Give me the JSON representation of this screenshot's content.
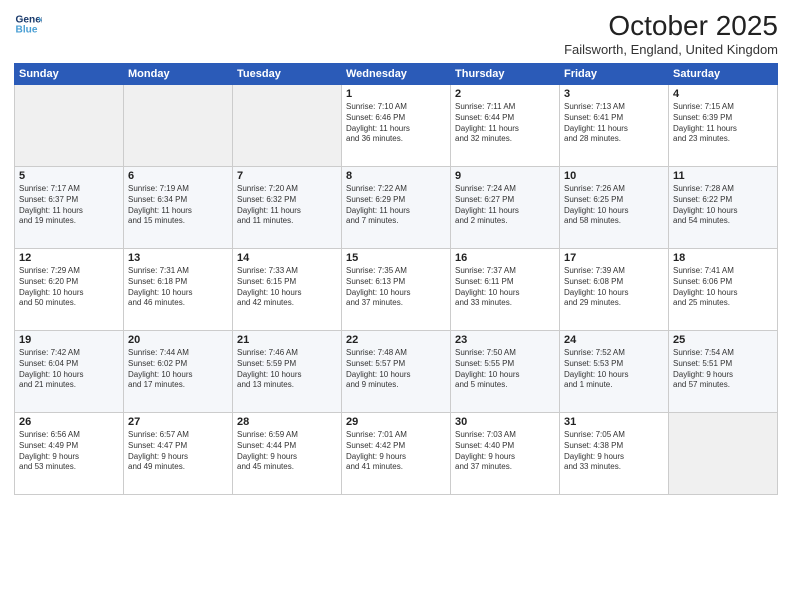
{
  "header": {
    "logo_line1": "General",
    "logo_line2": "Blue",
    "title": "October 2025",
    "location": "Failsworth, England, United Kingdom"
  },
  "days_of_week": [
    "Sunday",
    "Monday",
    "Tuesday",
    "Wednesday",
    "Thursday",
    "Friday",
    "Saturday"
  ],
  "weeks": [
    [
      {
        "day": "",
        "info": ""
      },
      {
        "day": "",
        "info": ""
      },
      {
        "day": "",
        "info": ""
      },
      {
        "day": "1",
        "info": "Sunrise: 7:10 AM\nSunset: 6:46 PM\nDaylight: 11 hours\nand 36 minutes."
      },
      {
        "day": "2",
        "info": "Sunrise: 7:11 AM\nSunset: 6:44 PM\nDaylight: 11 hours\nand 32 minutes."
      },
      {
        "day": "3",
        "info": "Sunrise: 7:13 AM\nSunset: 6:41 PM\nDaylight: 11 hours\nand 28 minutes."
      },
      {
        "day": "4",
        "info": "Sunrise: 7:15 AM\nSunset: 6:39 PM\nDaylight: 11 hours\nand 23 minutes."
      }
    ],
    [
      {
        "day": "5",
        "info": "Sunrise: 7:17 AM\nSunset: 6:37 PM\nDaylight: 11 hours\nand 19 minutes."
      },
      {
        "day": "6",
        "info": "Sunrise: 7:19 AM\nSunset: 6:34 PM\nDaylight: 11 hours\nand 15 minutes."
      },
      {
        "day": "7",
        "info": "Sunrise: 7:20 AM\nSunset: 6:32 PM\nDaylight: 11 hours\nand 11 minutes."
      },
      {
        "day": "8",
        "info": "Sunrise: 7:22 AM\nSunset: 6:29 PM\nDaylight: 11 hours\nand 7 minutes."
      },
      {
        "day": "9",
        "info": "Sunrise: 7:24 AM\nSunset: 6:27 PM\nDaylight: 11 hours\nand 2 minutes."
      },
      {
        "day": "10",
        "info": "Sunrise: 7:26 AM\nSunset: 6:25 PM\nDaylight: 10 hours\nand 58 minutes."
      },
      {
        "day": "11",
        "info": "Sunrise: 7:28 AM\nSunset: 6:22 PM\nDaylight: 10 hours\nand 54 minutes."
      }
    ],
    [
      {
        "day": "12",
        "info": "Sunrise: 7:29 AM\nSunset: 6:20 PM\nDaylight: 10 hours\nand 50 minutes."
      },
      {
        "day": "13",
        "info": "Sunrise: 7:31 AM\nSunset: 6:18 PM\nDaylight: 10 hours\nand 46 minutes."
      },
      {
        "day": "14",
        "info": "Sunrise: 7:33 AM\nSunset: 6:15 PM\nDaylight: 10 hours\nand 42 minutes."
      },
      {
        "day": "15",
        "info": "Sunrise: 7:35 AM\nSunset: 6:13 PM\nDaylight: 10 hours\nand 37 minutes."
      },
      {
        "day": "16",
        "info": "Sunrise: 7:37 AM\nSunset: 6:11 PM\nDaylight: 10 hours\nand 33 minutes."
      },
      {
        "day": "17",
        "info": "Sunrise: 7:39 AM\nSunset: 6:08 PM\nDaylight: 10 hours\nand 29 minutes."
      },
      {
        "day": "18",
        "info": "Sunrise: 7:41 AM\nSunset: 6:06 PM\nDaylight: 10 hours\nand 25 minutes."
      }
    ],
    [
      {
        "day": "19",
        "info": "Sunrise: 7:42 AM\nSunset: 6:04 PM\nDaylight: 10 hours\nand 21 minutes."
      },
      {
        "day": "20",
        "info": "Sunrise: 7:44 AM\nSunset: 6:02 PM\nDaylight: 10 hours\nand 17 minutes."
      },
      {
        "day": "21",
        "info": "Sunrise: 7:46 AM\nSunset: 5:59 PM\nDaylight: 10 hours\nand 13 minutes."
      },
      {
        "day": "22",
        "info": "Sunrise: 7:48 AM\nSunset: 5:57 PM\nDaylight: 10 hours\nand 9 minutes."
      },
      {
        "day": "23",
        "info": "Sunrise: 7:50 AM\nSunset: 5:55 PM\nDaylight: 10 hours\nand 5 minutes."
      },
      {
        "day": "24",
        "info": "Sunrise: 7:52 AM\nSunset: 5:53 PM\nDaylight: 10 hours\nand 1 minute."
      },
      {
        "day": "25",
        "info": "Sunrise: 7:54 AM\nSunset: 5:51 PM\nDaylight: 9 hours\nand 57 minutes."
      }
    ],
    [
      {
        "day": "26",
        "info": "Sunrise: 6:56 AM\nSunset: 4:49 PM\nDaylight: 9 hours\nand 53 minutes."
      },
      {
        "day": "27",
        "info": "Sunrise: 6:57 AM\nSunset: 4:47 PM\nDaylight: 9 hours\nand 49 minutes."
      },
      {
        "day": "28",
        "info": "Sunrise: 6:59 AM\nSunset: 4:44 PM\nDaylight: 9 hours\nand 45 minutes."
      },
      {
        "day": "29",
        "info": "Sunrise: 7:01 AM\nSunset: 4:42 PM\nDaylight: 9 hours\nand 41 minutes."
      },
      {
        "day": "30",
        "info": "Sunrise: 7:03 AM\nSunset: 4:40 PM\nDaylight: 9 hours\nand 37 minutes."
      },
      {
        "day": "31",
        "info": "Sunrise: 7:05 AM\nSunset: 4:38 PM\nDaylight: 9 hours\nand 33 minutes."
      },
      {
        "day": "",
        "info": ""
      }
    ]
  ]
}
